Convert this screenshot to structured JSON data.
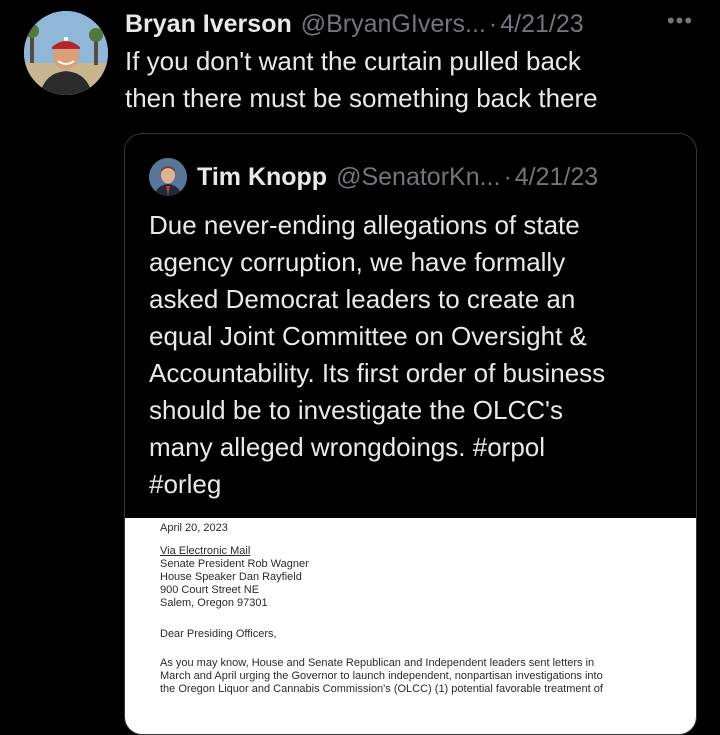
{
  "tweet": {
    "name": "Bryan Iverson",
    "handle": "@BryanGIvers...",
    "separator": "·",
    "date": "4/21/23",
    "more": "•••",
    "text_lines": [
      "If you don't want the curtain pulled back",
      "then there must be something back there"
    ]
  },
  "quote": {
    "name": "Tim Knopp",
    "handle": "@SenatorKn...",
    "separator": "·",
    "date": "4/21/23",
    "text_lines": [
      "Due never-ending allegations of state",
      "agency corruption, we have formally",
      "asked Democrat leaders to create an",
      "equal Joint Committee on Oversight &",
      "Accountability. Its first order of business",
      "should be to investigate the OLCC's",
      "many alleged wrongdoings. #orpol",
      "#orleg"
    ]
  },
  "letter": {
    "date": "April 20, 2023",
    "via": "Via Electronic Mail",
    "address": [
      "Senate President Rob Wagner",
      "House Speaker Dan Rayfield",
      "900 Court Street NE",
      "Salem, Oregon 97301"
    ],
    "salutation": "Dear Presiding Officers,",
    "body_lines": [
      "As you may know, House and Senate Republican and Independent leaders sent letters in",
      "March and April urging the Governor to launch independent, nonpartisan investigations into",
      "the Oregon Liquor and Cannabis Commission's (OLCC) (1) potential favorable treatment of"
    ]
  },
  "icons": {
    "avatar": "profile-photo",
    "quote_avatar": "profile-photo",
    "more": "more-options-icon"
  }
}
